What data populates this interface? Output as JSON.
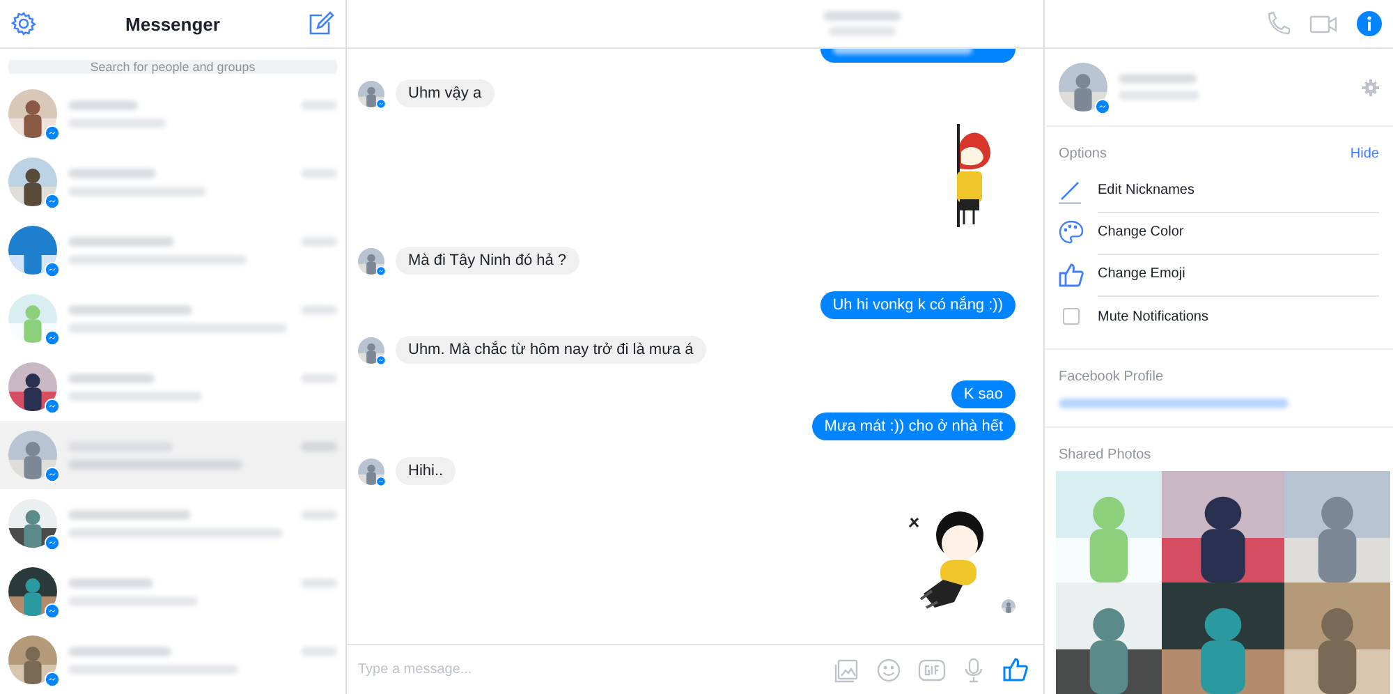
{
  "sidebar": {
    "title": "Messenger",
    "search": {
      "placeholder": "Search for people and groups"
    },
    "conversations": [
      {
        "selected": false
      },
      {
        "selected": false
      },
      {
        "selected": false
      },
      {
        "selected": false
      },
      {
        "selected": false
      },
      {
        "selected": true
      },
      {
        "selected": false
      },
      {
        "selected": false
      },
      {
        "selected": false
      }
    ]
  },
  "chat": {
    "messages": [
      {
        "kind": "sent",
        "redacted": true
      },
      {
        "kind": "received",
        "text": "Uhm vậy a"
      },
      {
        "kind": "sticker"
      },
      {
        "kind": "received",
        "text": "Mà đi Tây Ninh đó hả ?"
      },
      {
        "kind": "sent",
        "text": "Uh hi vonkg k có nắng :))"
      },
      {
        "kind": "received",
        "text": "Uhm. Mà chắc từ hôm nay trở đi là mưa á"
      },
      {
        "kind": "sent",
        "text": "K sao"
      },
      {
        "kind": "sent",
        "text": "Mưa mát :)) cho ở nhà hết",
        "grouped": true
      },
      {
        "kind": "received",
        "text": "Hihi.."
      },
      {
        "kind": "sticker",
        "seen": true
      }
    ],
    "composer": {
      "placeholder": "Type a message..."
    }
  },
  "details": {
    "options_label": "Options",
    "hide_link": "Hide",
    "options": [
      {
        "kind": "pencil",
        "label": "Edit Nicknames"
      },
      {
        "kind": "palette",
        "label": "Change Color"
      },
      {
        "kind": "thumb",
        "label": "Change Emoji"
      },
      {
        "kind": "checkbox",
        "label": "Mute Notifications",
        "checked": false
      }
    ],
    "profile_label": "Facebook Profile",
    "photos_label": "Shared Photos"
  }
}
